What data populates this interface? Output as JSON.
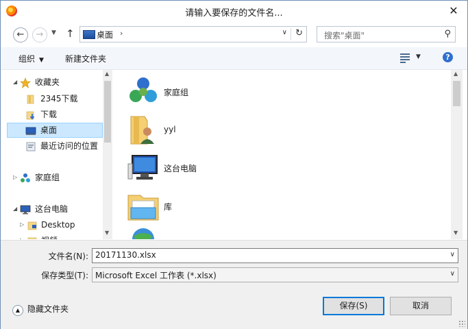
{
  "window": {
    "title": "请输入要保存的文件名..."
  },
  "nav": {
    "address": "桌面",
    "search_placeholder": "搜索\"桌面\""
  },
  "toolbar": {
    "organize": "组织",
    "new_folder": "新建文件夹"
  },
  "tree": {
    "favorites": "收藏夹",
    "item_2345": "2345下载",
    "downloads": "下载",
    "desktop": "桌面",
    "recent": "最近访问的位置",
    "homegroup": "家庭组",
    "this_pc": "这台电脑",
    "desktop_en": "Desktop",
    "videos": "视频"
  },
  "content": {
    "items": [
      "家庭组",
      "yyl",
      "这台电脑",
      "库",
      ""
    ]
  },
  "form": {
    "filename_label": "文件名(N):",
    "filename_value": "20171130.xlsx",
    "type_label": "保存类型(T):",
    "type_value": "Microsoft Excel 工作表 (*.xlsx)"
  },
  "buttons": {
    "hide_folders": "隐藏文件夹",
    "save": "保存(S)",
    "cancel": "取消"
  },
  "colors": {
    "selection": "#cce8ff",
    "accent": "#0078d7"
  }
}
